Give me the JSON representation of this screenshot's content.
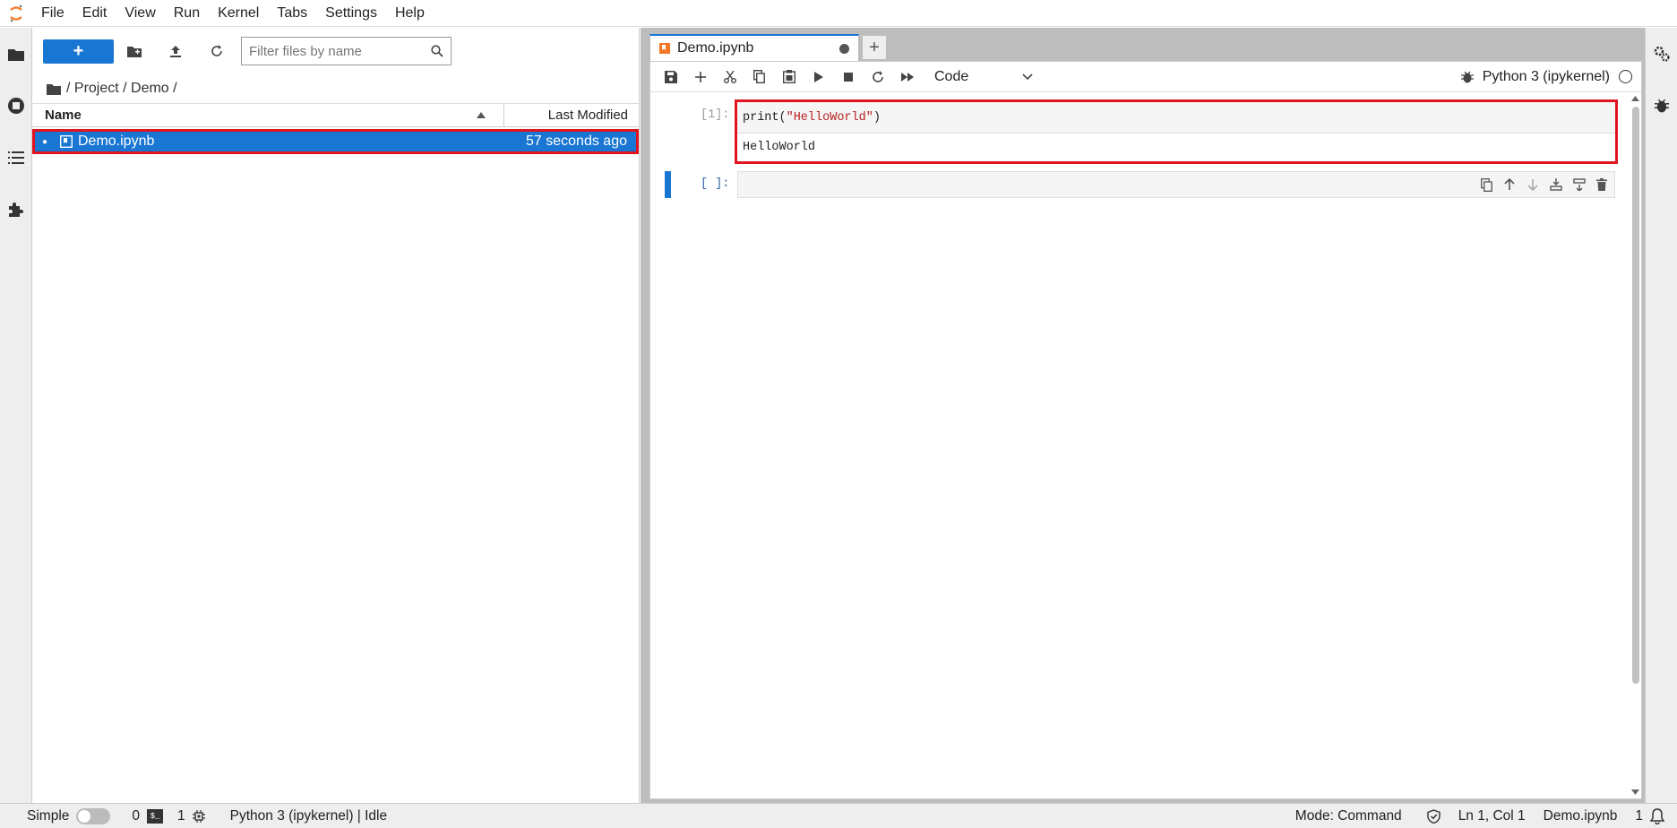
{
  "menubar": {
    "items": [
      "File",
      "Edit",
      "View",
      "Run",
      "Kernel",
      "Tabs",
      "Settings",
      "Help"
    ]
  },
  "filebrowser": {
    "new_label": "+",
    "filter_placeholder": "Filter files by name",
    "breadcrumb": "/ Project / Demo /",
    "col_name": "Name",
    "col_modified": "Last Modified",
    "files": [
      {
        "name": "Demo.ipynb",
        "modified": "57 seconds ago",
        "selected": true
      }
    ]
  },
  "tabs": [
    {
      "label": "Demo.ipynb",
      "modified": true
    }
  ],
  "toolbar": {
    "cell_type": "Code",
    "kernel_name": "Python 3 (ipykernel)"
  },
  "cells": [
    {
      "prompt": "[1]:",
      "code_prefix": "print(",
      "code_string": "\"HelloWorld\"",
      "code_suffix": ")",
      "output": "HelloWorld"
    },
    {
      "prompt": "[ ]:"
    }
  ],
  "statusbar": {
    "mode_label": "Simple",
    "terminals": "0",
    "kernels": "1",
    "kernel_status": "Python 3 (ipykernel) | Idle",
    "mode": "Mode: Command",
    "cursor": "Ln 1, Col 1",
    "file": "Demo.ipynb",
    "notifications": "1"
  },
  "colors": {
    "accent": "#1976d2",
    "highlight": "#e0141e",
    "string": "#ba2121"
  }
}
